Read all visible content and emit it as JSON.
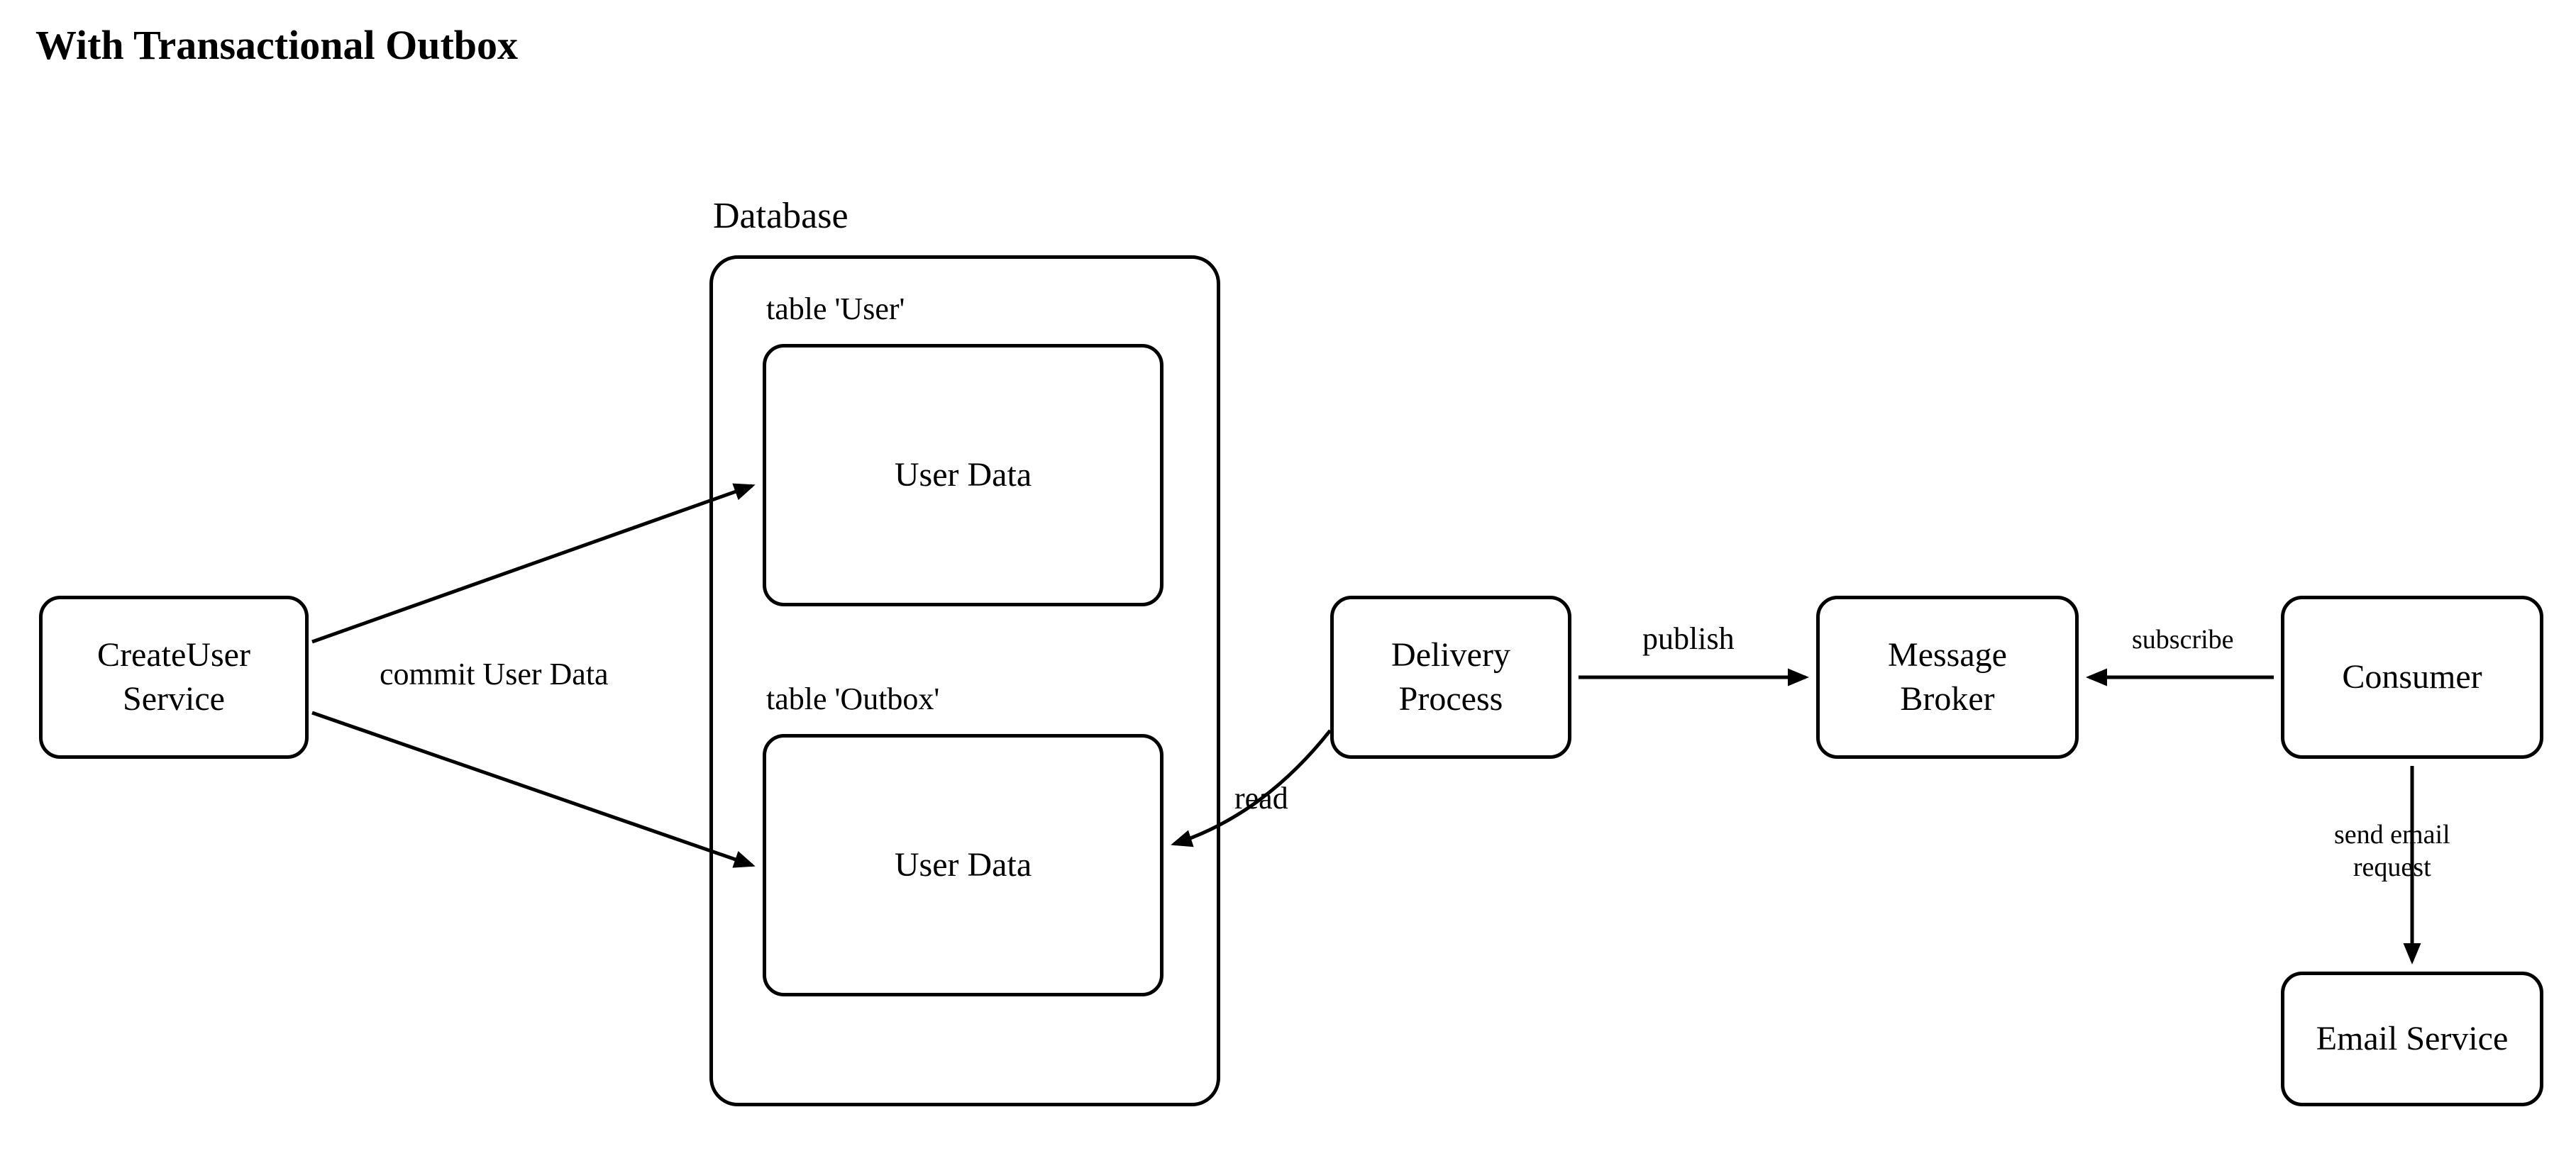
{
  "title": "With Transactional Outbox",
  "database_label": "Database",
  "table_user_label": "table 'User'",
  "table_outbox_label": "table 'Outbox'",
  "nodes": {
    "create_user": "CreateUser\nService",
    "user_data_1": "User Data",
    "user_data_2": "User Data",
    "delivery_process": "Delivery\nProcess",
    "message_broker": "Message\nBroker",
    "consumer": "Consumer",
    "email_service": "Email Service"
  },
  "edges": {
    "commit": "commit  User Data",
    "read": "read",
    "publish": "publish",
    "subscribe": "subscribe",
    "send_email": "send email\nrequest"
  }
}
